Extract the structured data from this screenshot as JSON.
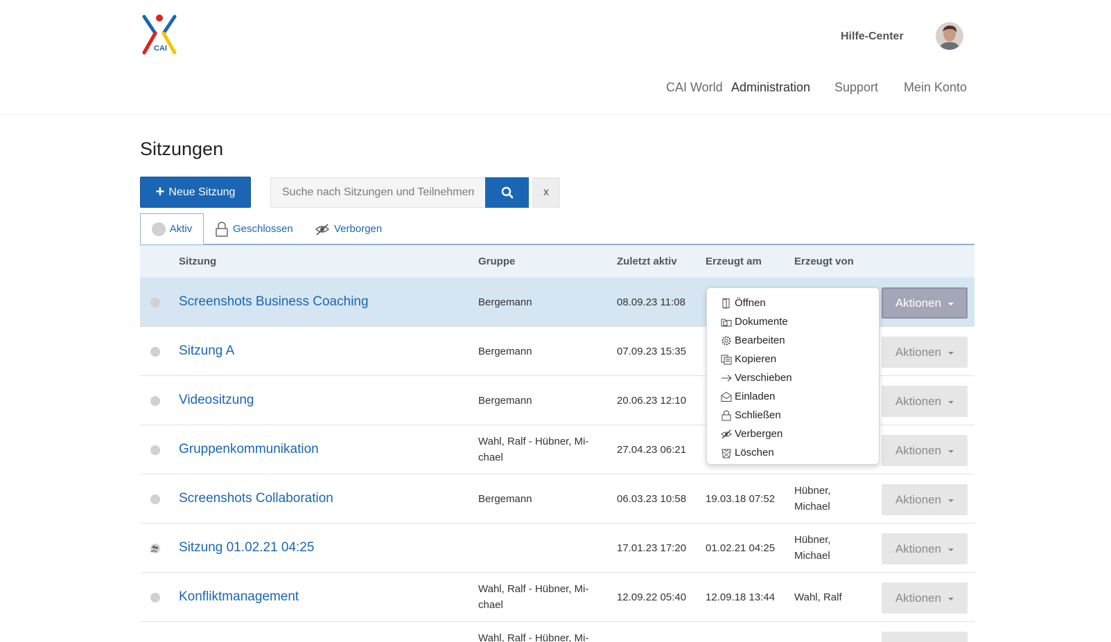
{
  "header": {
    "logo_text": "CAI",
    "help_label": "Hilfe-Center",
    "nav": [
      "CAI World",
      "Administration",
      "Support",
      "Mein Konto"
    ],
    "active_nav": "Administration"
  },
  "page": {
    "title": "Sitzungen"
  },
  "toolbar": {
    "new_label": "Neue Sitzung",
    "search_placeholder": "Suche nach Sitzungen und Teilnehmern",
    "clear_label": "x"
  },
  "tabs": [
    {
      "label": "Aktiv",
      "icon": "circle-icon",
      "active": true
    },
    {
      "label": "Geschlossen",
      "icon": "lock-icon",
      "active": false
    },
    {
      "label": "Verborgen",
      "icon": "hidden-eye-icon",
      "active": false
    }
  ],
  "table": {
    "headers": [
      "Sitzung",
      "Gruppe",
      "Zuletzt aktiv",
      "Erzeugt am",
      "Erzeugt von"
    ],
    "actions_label": "Aktionen",
    "rows": [
      {
        "name": "Screenshots Business Coaching",
        "group": "Bergemann",
        "last_active": "08.09.23 11:08",
        "created_at": "",
        "created_by": ""
      },
      {
        "name": "Sitzung A",
        "group": "Bergemann",
        "last_active": "07.09.23 15:35",
        "created_at": "",
        "created_by": ""
      },
      {
        "name": "Videositzung",
        "group": "Bergemann",
        "last_active": "20.06.23 12:10",
        "created_at": "",
        "created_by": ""
      },
      {
        "name": "Gruppenkommunikation",
        "group": "Wahl, Ralf - Hübner, Mi-chael",
        "last_active": "27.04.23 06:21",
        "created_at": "",
        "created_by": ""
      },
      {
        "name": "Screenshots Collaboration",
        "group": "Bergemann",
        "last_active": "06.03.23 10:58",
        "created_at": "19.03.18 07:52",
        "created_by": "Hübner, Michael"
      },
      {
        "name": "Sitzung 01.02.21 04:25",
        "group": "",
        "last_active": "17.01.23 17:20",
        "created_at": "01.02.21 04:25",
        "created_by": "Hübner, Michael"
      },
      {
        "name": "Konfliktmanagement",
        "group": "Wahl, Ralf - Hübner, Mi-chael",
        "last_active": "12.09.22 05:40",
        "created_at": "12.09.18 13:44",
        "created_by": "Wahl, Ralf"
      },
      {
        "name": "",
        "group": "Wahl, Ralf - Hübner, Mi-chael",
        "last_active": "",
        "created_at": "",
        "created_by": ""
      }
    ]
  },
  "menu": {
    "items": [
      {
        "label": "Öffnen",
        "icon": "door-icon"
      },
      {
        "label": "Dokumente",
        "icon": "folder-icon"
      },
      {
        "label": "Bearbeiten",
        "icon": "gear-icon"
      },
      {
        "label": "Kopieren",
        "icon": "copy-icon"
      },
      {
        "label": "Verschieben",
        "icon": "arrow-right-icon"
      },
      {
        "label": "Einladen",
        "icon": "envelope-icon"
      },
      {
        "label": "Schließen",
        "icon": "lock-icon"
      },
      {
        "label": "Verbergen",
        "icon": "hidden-eye-icon"
      },
      {
        "label": "Löschen",
        "icon": "trash-icon"
      }
    ]
  },
  "colors": {
    "primary": "#1a66b5",
    "header_row": "#ebf2f8",
    "highlight_row": "#d5e5f2",
    "actions_button": "#e6e6e6",
    "actions_button_open": "#a5a5b8"
  }
}
